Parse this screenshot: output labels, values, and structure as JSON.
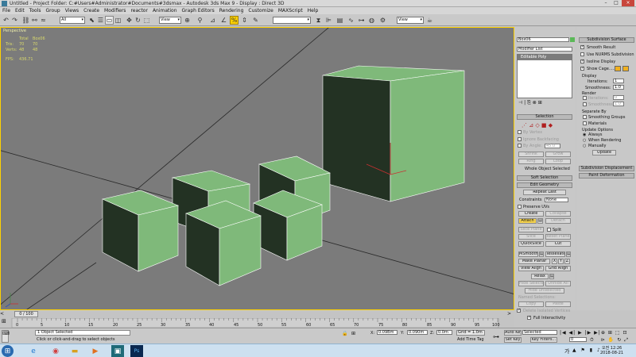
{
  "titlebar": {
    "title": "Untitled    - Project Folder: C:#Users#Administrator#Documents#3dsmax    - Autodesk 3ds Max 9    - Display : Direct 3D",
    "buttons": [
      "–",
      "□",
      "×"
    ]
  },
  "menubar": {
    "items": [
      "File",
      "Edit",
      "Tools",
      "Group",
      "Views",
      "Create",
      "Modifiers",
      "reactor",
      "Animation",
      "Graph Editors",
      "Rendering",
      "Customize",
      "MAXScript",
      "Help"
    ]
  },
  "toolbar": {
    "selection_filter": "All",
    "ref_coord": "View",
    "named_sel": "",
    "render_view": "View"
  },
  "viewport": {
    "label": "Perspective",
    "stats": {
      "headers": [
        "",
        "Total",
        "Box06"
      ],
      "rows": [
        [
          "Tris:",
          "70",
          "70"
        ],
        [
          "Verts:",
          "48",
          "48"
        ]
      ],
      "fps_label": "FPS:",
      "fps": "436.71"
    },
    "colors": {
      "box_light": "#7fb97a",
      "box_dark": "#233223",
      "bg": "#7b7b7b"
    }
  },
  "command_panel": {
    "object_name": "Box06",
    "modifier_list": "Modifier List",
    "stack_item": "Editable Poly",
    "selection": {
      "title": "Selection",
      "by_vertex": "By Vertex",
      "ignore_backfacing": "Ignore Backfacing",
      "by_angle": "By Angle:",
      "angle": "45.0",
      "shrink": "Shrink",
      "grow": "Grow",
      "ring": "Ring",
      "loop": "Loop",
      "status": "Whole Object Selected"
    },
    "soft_selection": "Soft Selection",
    "edit_geometry": {
      "title": "Edit Geometry",
      "repeat_last": "Repeat Last",
      "constraints": "Constraints",
      "constraints_value": "None",
      "preserve_uvs": "Preserve UVs",
      "create": "Create",
      "collapse": "Collapse",
      "attach": "Attach",
      "detach": "Detach",
      "slice_plane": "Slice Plane",
      "split": "Split",
      "slice": "Slice",
      "reset_plane": "Reset Plane",
      "quickslice": "QuickSlice",
      "cut": "Cut",
      "msmooth": "MSmooth",
      "tessellate": "Tessellate",
      "make_planar": "Make Planar",
      "x": "X",
      "y": "Y",
      "z": "Z",
      "view_align": "View Align",
      "grid_align": "Grid Align",
      "relax": "Relax",
      "hide_selected": "Hide Selected",
      "unhide_all": "Unhide All",
      "hide_unselected": "Hide Unselected",
      "named_selections": "Named Selections:",
      "copy": "Copy",
      "paste": "Paste",
      "delete_isolated": "Delete Isolated Vertices",
      "full_interactivity": "Full Interactivity"
    }
  },
  "right_panel": {
    "subdivision_surface": "Subdivision Surface",
    "smooth_result": "Smooth Result",
    "use_nurms": "Use NURMS Subdivision",
    "isoline_display": "Isoline Display",
    "show_cage": "Show Cage......",
    "display": "Display",
    "iterations_label": "Iterations:",
    "iterations": "1",
    "smoothness_label": "Smoothness:",
    "smoothness": "1.0",
    "render": "Render",
    "render_iterations": "0",
    "render_smoothness": "1.0",
    "separate_by": "Separate By",
    "smoothing_groups": "Smoothing Groups",
    "materials": "Materials",
    "update_options": "Update Options",
    "always": "Always",
    "when_rendering": "When Rendering",
    "manually": "Manually",
    "update": "Update",
    "subdivision_displacement": "Subdivision Displacement",
    "paint_deformation": "Paint Deformation"
  },
  "timeline": {
    "frame": "0 / 100",
    "ticks": [
      "0",
      "5",
      "10",
      "15",
      "20",
      "25",
      "30",
      "35",
      "40",
      "45",
      "50",
      "55",
      "60",
      "65",
      "70",
      "75",
      "80",
      "85",
      "90",
      "95",
      "100"
    ]
  },
  "status": {
    "selection": "1 Object Selected",
    "prompt": "Click or click-and-drag to select objects",
    "x_label": "X:",
    "x": "0.09Bm",
    "y_label": "Y:",
    "y": "0.090m",
    "z_label": "Z:",
    "z": "0.0m",
    "grid": "Grid = 1.0m",
    "add_time_tag": "Add Time Tag",
    "auto_key": "Auto Key",
    "selected": "Selected",
    "set_key": "Set Key",
    "key_filters": "Key Filters...",
    "frame_field": "0"
  },
  "taskbar": {
    "time": "오전 12:26",
    "date": "2018-08-21",
    "lang": "가",
    "icons": [
      "start-orb-icon",
      "ie-icon",
      "chrome-icon",
      "folder-icon",
      "media-player-icon",
      "3dsmax-icon",
      "photoshop-icon"
    ]
  }
}
